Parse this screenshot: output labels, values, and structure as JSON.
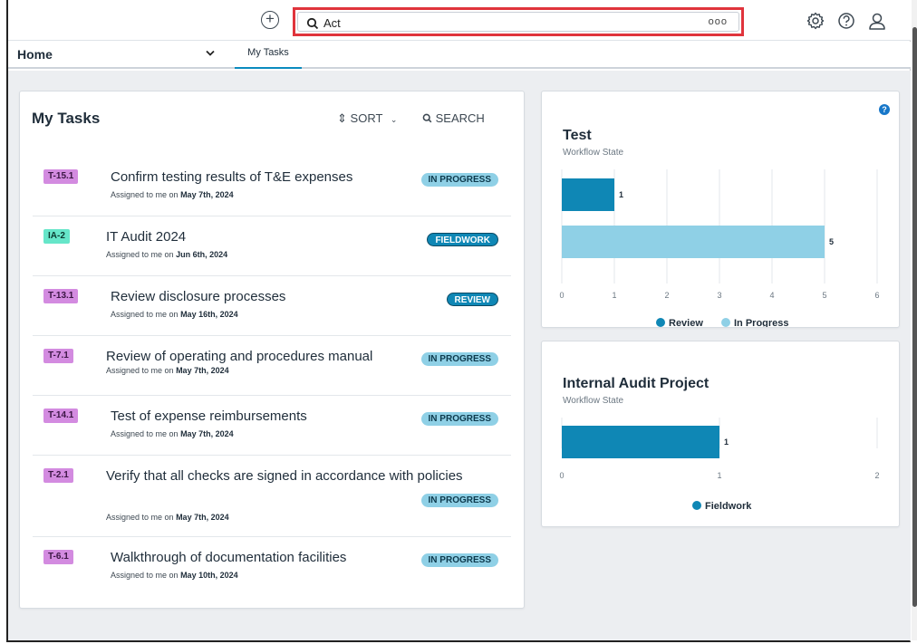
{
  "topbar": {
    "search_value": "Act",
    "more_label": "ooo"
  },
  "nav": {
    "home_label": "Home",
    "tab_label": "My Tasks"
  },
  "tasks": {
    "title": "My Tasks",
    "sort_label": "SORT",
    "search_label": "SEARCH",
    "items": [
      {
        "id": "T-15.1",
        "tag_color": "purple",
        "title": "Confirm testing results of T&E expenses",
        "assigned_prefix": "Assigned to me on",
        "date": "May 7th, 2024",
        "status": "IN PROGRESS",
        "status_style": "light"
      },
      {
        "id": "IA-2",
        "tag_color": "teal",
        "title": "IT Audit 2024",
        "assigned_prefix": "Assigned to me on",
        "date": "Jun 6th, 2024",
        "status": "FIELDWORK",
        "status_style": "dark"
      },
      {
        "id": "T-13.1",
        "tag_color": "purple",
        "title": "Review disclosure processes",
        "assigned_prefix": "Assigned to me on",
        "date": "May 16th, 2024",
        "status": "REVIEW",
        "status_style": "dark"
      },
      {
        "id": "T-7.1",
        "tag_color": "purple",
        "title": "Review of operating and procedures manual",
        "assigned_prefix": "Assigned to me on",
        "date": "May 7th, 2024",
        "status": "IN PROGRESS",
        "status_style": "light"
      },
      {
        "id": "T-14.1",
        "tag_color": "purple",
        "title": "Test of expense reimbursements",
        "assigned_prefix": "Assigned to me on",
        "date": "May 7th, 2024",
        "status": "IN PROGRESS",
        "status_style": "light"
      },
      {
        "id": "T-2.1",
        "tag_color": "purple",
        "title": "Verify that all checks are signed in accordance with policies",
        "assigned_prefix": "Assigned to me on",
        "date": "May 7th, 2024",
        "status": "IN PROGRESS",
        "status_style": "light"
      },
      {
        "id": "T-6.1",
        "tag_color": "purple",
        "title": "Walkthrough of documentation facilities",
        "assigned_prefix": "Assigned to me on",
        "date": "May 10th, 2024",
        "status": "IN PROGRESS",
        "status_style": "light"
      }
    ]
  },
  "help_label": "?",
  "colors": {
    "review": "#0f87b5",
    "in_progress": "#8fd0e6",
    "fieldwork": "#0f87b5",
    "accent": "#0a8bbf",
    "search_highlight": "#e0343c"
  },
  "chart_data": [
    {
      "type": "bar",
      "title": "Test",
      "subtitle": "Workflow State",
      "orientation": "horizontal",
      "series": [
        {
          "name": "Review",
          "value": 1
        },
        {
          "name": "In Progress",
          "value": 5
        }
      ],
      "xlim": [
        0,
        6
      ],
      "xticks": [
        "0",
        "1",
        "2",
        "3",
        "4",
        "5",
        "6"
      ],
      "legend": [
        "Review",
        "In Progress"
      ],
      "legend_placement": "bottom",
      "grid": true
    },
    {
      "type": "bar",
      "title": "Internal Audit Project",
      "subtitle": "Workflow State",
      "orientation": "horizontal",
      "series": [
        {
          "name": "Fieldwork",
          "value": 1
        }
      ],
      "xlim": [
        0,
        2
      ],
      "xticks": [
        "0",
        "1",
        "2"
      ],
      "legend": [
        "Fieldwork"
      ],
      "legend_placement": "bottom",
      "grid": true
    }
  ]
}
